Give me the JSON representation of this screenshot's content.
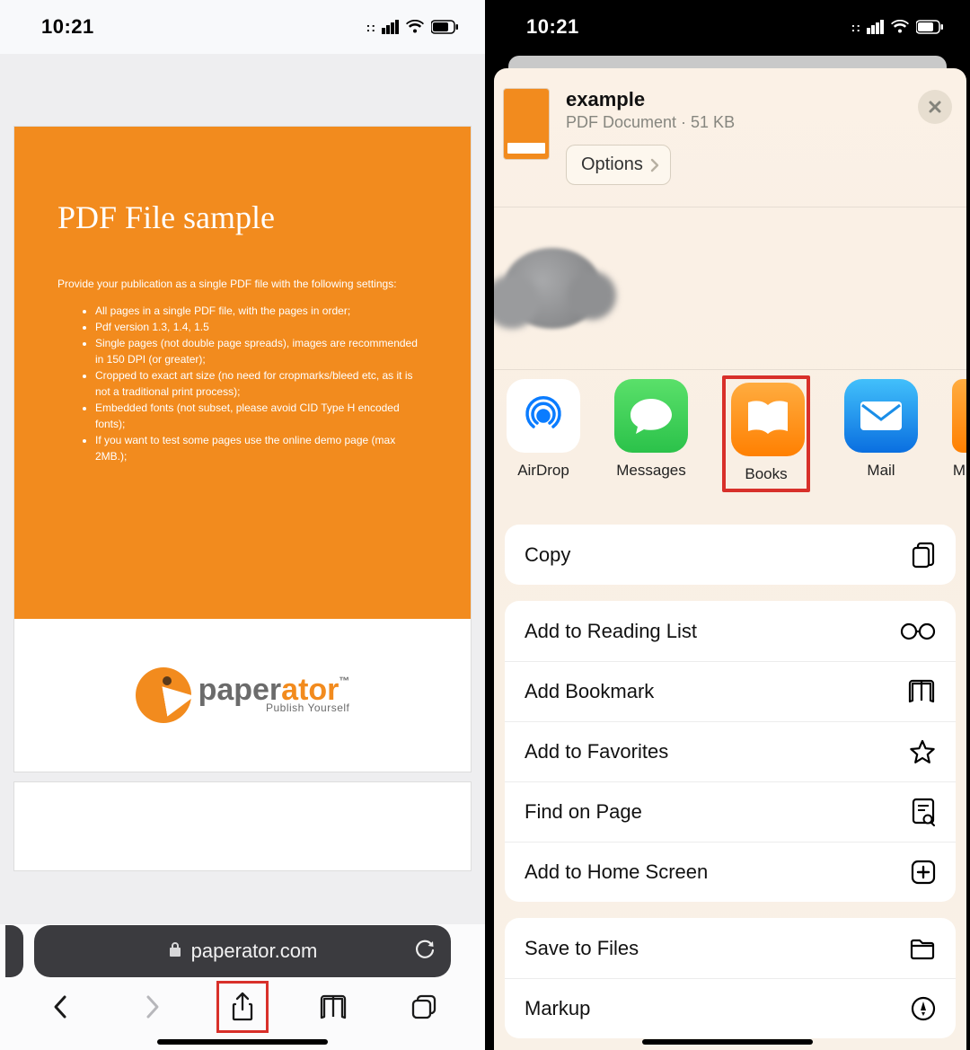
{
  "status": {
    "time": "10:21"
  },
  "left": {
    "pdf": {
      "title": "PDF File sample",
      "subtitle": "Provide your publication as a single PDF file with the following settings:",
      "bullets": [
        "All pages in a single PDF file, with the pages in order;",
        "Pdf version 1.3, 1.4, 1.5",
        "Single pages (not double page spreads), images are recommended in 150 DPI (or greater);",
        "Cropped to exact art size (no need for cropmarks/bleed etc, as it is not a traditional print process);",
        "Embedded fonts (not subset, please avoid CID Type H encoded fonts);",
        "If you want to test some pages use the online demo page (max 2MB.);"
      ],
      "logo_main": "paper",
      "logo_accent": "ator",
      "logo_tm": "™",
      "logo_tag": "Publish Yourself"
    },
    "address": {
      "domain": "paperator.com"
    }
  },
  "right": {
    "doc": {
      "title": "example",
      "meta": "PDF Document · 51 KB",
      "options": "Options"
    },
    "apps": {
      "airdrop": "AirDrop",
      "messages": "Messages",
      "books": "Books",
      "mail": "Mail",
      "more": "M"
    },
    "actions": {
      "copy": "Copy",
      "reading": "Add to Reading List",
      "bookmark": "Add Bookmark",
      "favorites": "Add to Favorites",
      "find": "Find on Page",
      "homescreen": "Add to Home Screen",
      "save": "Save to Files",
      "markup": "Markup"
    }
  }
}
